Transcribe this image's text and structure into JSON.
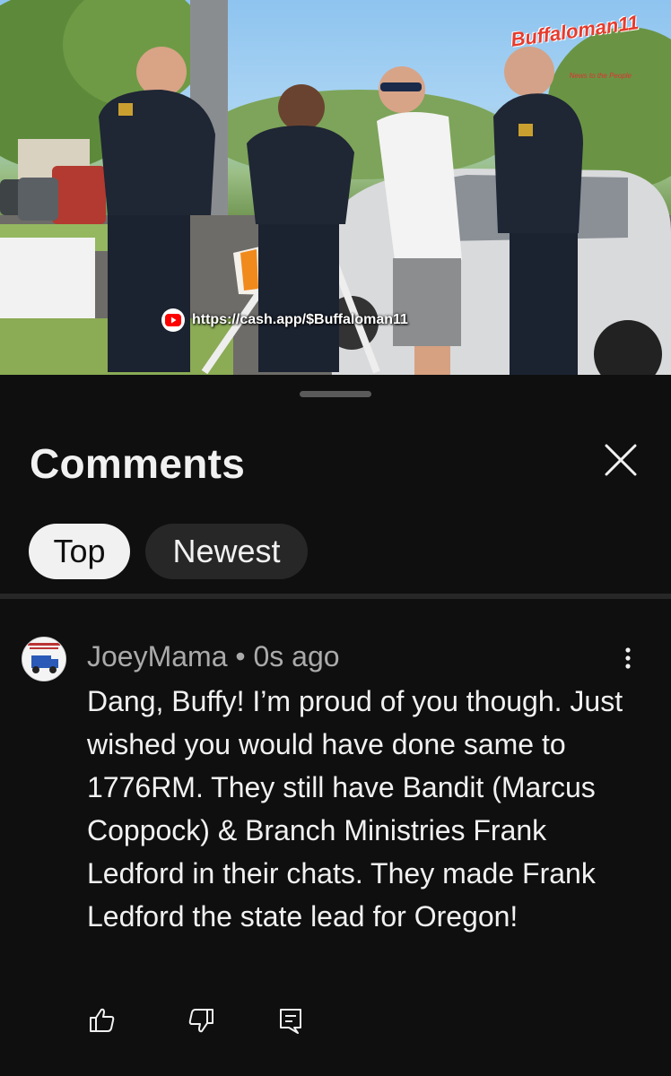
{
  "video": {
    "watermark": "Buffaloman11",
    "watermark_tagline": "News to the People",
    "overlay_url": "https://cash.app/$Buffaloman11",
    "overlay_icon": "youtube-icon"
  },
  "comments_panel": {
    "title": "Comments",
    "close_icon": "close-icon",
    "filters": [
      {
        "label": "Top",
        "selected": true
      },
      {
        "label": "Newest",
        "selected": false
      }
    ]
  },
  "comment": {
    "author": "JoeyMama",
    "separator": "•",
    "time": "0s ago",
    "text": "Dang, Buffy! I’m proud of you though. Just wished you would have done same to 1776RM. They still have Bandit (Marcus Coppock) & Branch Ministries Frank Ledford in their chats. They made Frank Ledford the state lead for Oregon!",
    "actions": [
      "like-icon",
      "dislike-icon",
      "reply-icon"
    ],
    "menu_icon": "more-vertical-icon"
  },
  "colors": {
    "background": "#0f0f0f",
    "chip_selected_bg": "#f1f1f1",
    "chip_bg": "#272727",
    "secondary_text": "#aaaaaa"
  }
}
